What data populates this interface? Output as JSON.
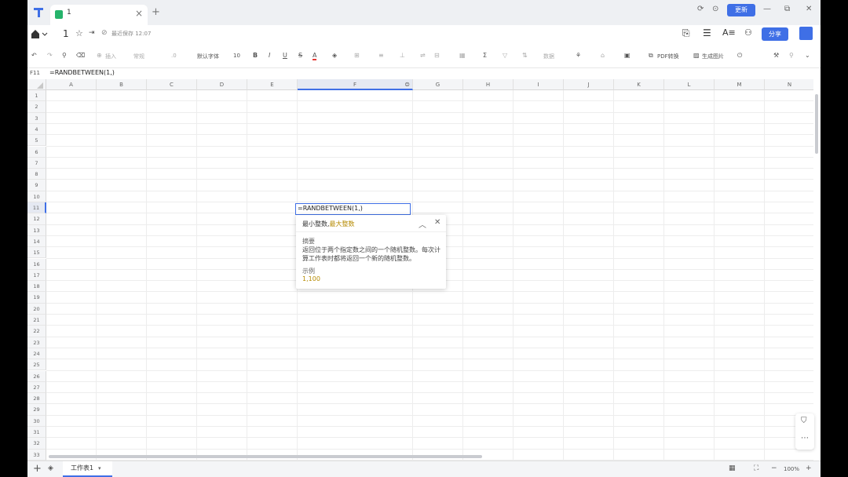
{
  "titlebar": {
    "tab_title": "1",
    "update_label": "更新"
  },
  "docbar": {
    "doc_title": "1",
    "save_status": "最近保存 12:07",
    "share_label": "分享"
  },
  "toolbar": {
    "insert_label": "插入",
    "format_label": "常规",
    "decimal_label": ".0",
    "font_label": "默认字体",
    "font_size": "10",
    "bold": "B",
    "italic": "I",
    "underline": "U",
    "strike": "S",
    "font_color": "A",
    "data_label": "数据",
    "pdf_label": "PDF转换",
    "image_label": "生成图片"
  },
  "formula_bar": {
    "cell_ref": "F11",
    "formula": "=RANDBETWEEN(1,)"
  },
  "grid": {
    "columns": [
      "A",
      "B",
      "C",
      "D",
      "E",
      "F",
      "G",
      "H",
      "I",
      "J",
      "K",
      "L",
      "M",
      "N"
    ],
    "active_column": "F",
    "rows": [
      "1",
      "2",
      "3",
      "4",
      "5",
      "6",
      "7",
      "8",
      "9",
      "10",
      "11",
      "12",
      "13",
      "14",
      "15",
      "16",
      "17",
      "18",
      "19",
      "20",
      "21",
      "22",
      "23",
      "24",
      "25",
      "26",
      "27",
      "28",
      "29",
      "30",
      "31",
      "32",
      "33"
    ],
    "active_row": "11",
    "active_cell_value": "=RANDBETWEEN(1,)"
  },
  "tooltip": {
    "signature_arg1": "最小整数,",
    "signature_arg2": "最大整数",
    "summary_label": "摘要",
    "summary_text": "返回位于两个指定数之间的一个随机整数。每次计算工作表时都将返回一个新的随机整数。",
    "example_label": "示例",
    "example_value": "1,100"
  },
  "sheetbar": {
    "sheet_name": "工作表1",
    "zoom": "100%"
  },
  "colors": {
    "accent": "#3f6fe6",
    "highlight": "#b58a00"
  }
}
